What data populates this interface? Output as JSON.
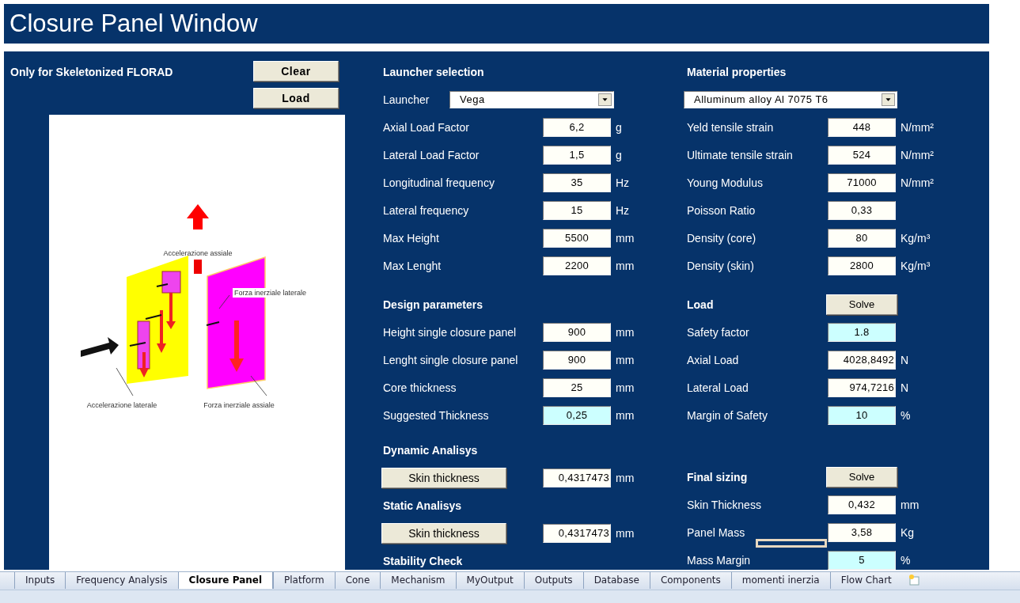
{
  "window": {
    "title": "Closure Panel Window"
  },
  "left_panel": {
    "heading": "Only for Skeletonized FLORAD",
    "buttons": [
      "Clear",
      "Load"
    ],
    "diagram": {
      "labels": [
        "Accelerazione assiale",
        "Forza inerziale laterale",
        "Accelerazione laterale",
        "Forza inerziale assiale"
      ]
    }
  },
  "middle_column": [
    {
      "heading": "Launcher selection",
      "rows": [
        {
          "kind": "dropdown",
          "label": "Launcher",
          "value": "Vega"
        },
        {
          "kind": "field",
          "label": "Axial Load Factor",
          "value": "6,2",
          "unit": "g",
          "highlighted": false
        },
        {
          "kind": "field",
          "label": "Lateral Load Factor",
          "value": "1,5",
          "unit": "g",
          "highlighted": false
        },
        {
          "kind": "field",
          "label": "Longitudinal frequency",
          "value": "35",
          "unit": "Hz",
          "highlighted": false
        },
        {
          "kind": "field",
          "label": "Lateral frequency",
          "value": "15",
          "unit": "Hz",
          "highlighted": false
        },
        {
          "kind": "field",
          "label": "Max Height",
          "value": "5500",
          "unit": "mm",
          "highlighted": false
        },
        {
          "kind": "field",
          "label": "Max Lenght",
          "value": "2200",
          "unit": "mm",
          "highlighted": false
        }
      ]
    },
    {
      "heading": "Design parameters",
      "rows": [
        {
          "kind": "field",
          "label": "Height single closure panel",
          "value": "900",
          "unit": "mm",
          "highlighted": false
        },
        {
          "kind": "field",
          "label": "Lenght single closure panel",
          "value": "900",
          "unit": "mm",
          "highlighted": false
        },
        {
          "kind": "field",
          "label": "Core thickness",
          "value": "25",
          "unit": "mm",
          "highlighted": false
        },
        {
          "kind": "field",
          "label": "Suggested Thickness",
          "value": "0,25",
          "unit": "mm",
          "highlighted": true
        }
      ]
    },
    {
      "heading": "Dynamic Analisys",
      "rows": [
        {
          "kind": "button",
          "label": "Skin thickness",
          "value": "0,4317473",
          "unit": "mm",
          "highlighted": false
        }
      ]
    },
    {
      "heading": "Static Analisys",
      "rows": [
        {
          "kind": "button",
          "label": "Skin thickness",
          "value": "0,4317473",
          "unit": "mm",
          "highlighted": false
        }
      ]
    },
    {
      "heading": "Stability Check"
    }
  ],
  "right_column": [
    {
      "heading": "Material properties",
      "rows": [
        {
          "kind": "dropdown",
          "value": "Alluminum alloy Al 7075 T6"
        },
        {
          "kind": "field",
          "label": "Yeld tensile strain",
          "value": "448",
          "unit": "N/mm²",
          "highlighted": false
        },
        {
          "kind": "field",
          "label": "Ultimate tensile strain",
          "value": "524",
          "unit": "N/mm²",
          "highlighted": false
        },
        {
          "kind": "field",
          "label": "Young Modulus",
          "value": "71000",
          "unit": "N/mm²",
          "highlighted": false
        },
        {
          "kind": "field",
          "label": "Poisson Ratio",
          "value": "0,33",
          "highlighted": false
        },
        {
          "kind": "field",
          "label": "Density (core)",
          "value": "80",
          "unit": "Kg/m³",
          "highlighted": false
        },
        {
          "kind": "field",
          "label": "Density (skin)",
          "value": "2800",
          "unit": "Kg/m³",
          "highlighted": false
        }
      ]
    },
    {
      "heading": "Load",
      "button": "Solve",
      "rows": [
        {
          "kind": "field",
          "label": "Safety factor",
          "value": "1.8",
          "highlighted": true
        },
        {
          "kind": "field",
          "label": "Axial Load",
          "value": "4028,8492",
          "unit": "N",
          "highlighted": false
        },
        {
          "kind": "field",
          "label": "Lateral Load",
          "value": "974,7216",
          "unit": "N",
          "highlighted": false
        },
        {
          "kind": "field",
          "label": "Margin of Safety",
          "value": "10",
          "unit": "%",
          "highlighted": true
        }
      ]
    },
    {
      "heading": "Final sizing",
      "button": "Solve",
      "rows": [
        {
          "kind": "field",
          "label": "Skin Thickness",
          "value": "0,432",
          "unit": "mm",
          "highlighted": false
        },
        {
          "kind": "field",
          "label": "Panel Mass",
          "value": "3,58",
          "unit": "Kg",
          "highlighted": false,
          "outline": true
        },
        {
          "kind": "field",
          "label": "Mass Margin",
          "value": "5",
          "unit": "%",
          "highlighted": true
        }
      ]
    }
  ],
  "sheet_tabs": [
    {
      "label": "Inputs",
      "selected": false
    },
    {
      "label": "Frequency Analysis",
      "selected": false
    },
    {
      "label": "Closure Panel",
      "selected": true
    },
    {
      "label": "Platform",
      "selected": false
    },
    {
      "label": "Cone",
      "selected": false
    },
    {
      "label": "Mechanism",
      "selected": false
    },
    {
      "label": "MyOutput",
      "selected": false
    },
    {
      "label": "Outputs",
      "selected": false
    },
    {
      "label": "Database",
      "selected": false
    },
    {
      "label": "Components",
      "selected": false
    },
    {
      "label": "momenti inerzia",
      "selected": false
    },
    {
      "label": "Flow Chart",
      "selected": false
    }
  ]
}
